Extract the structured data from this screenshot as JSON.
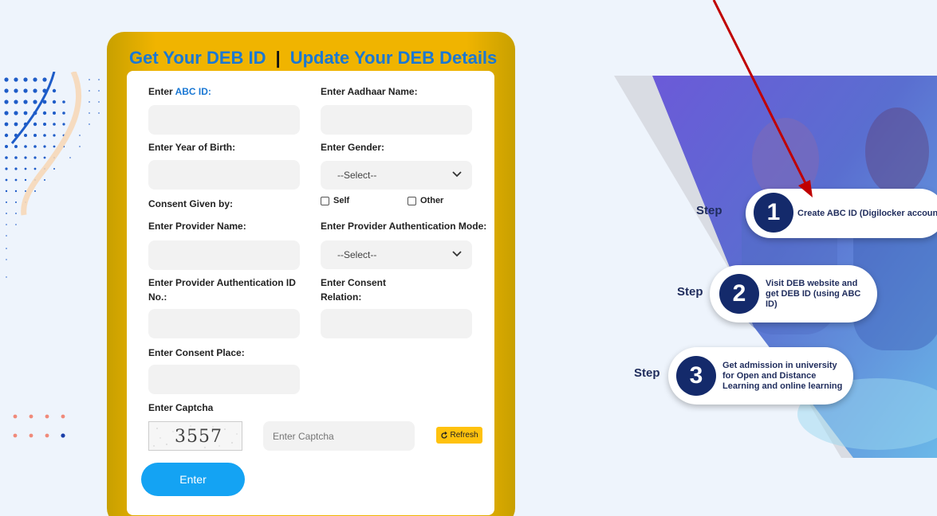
{
  "tabs": {
    "get_id": "Get Your DEB ID",
    "separator": "|",
    "update": "Update Your DEB Details"
  },
  "form": {
    "abc_id_prefix": "Enter ",
    "abc_id_accent": "ABC ID:",
    "aadhaar_name": "Enter Aadhaar Name:",
    "year_of_birth": "Enter Year of Birth:",
    "gender": "Enter Gender:",
    "gender_select": "--Select--",
    "consent_given_by": "Consent Given by:",
    "consent_self": "Self",
    "consent_other": "Other",
    "provider_name": "Enter Provider Name:",
    "provider_auth_mode": "Enter Provider Authentication Mode:",
    "auth_mode_select": "--Select--",
    "provider_auth_id": "Enter Provider Authentication ID No.:",
    "consent_relation": "Enter Consent Relation:",
    "consent_place": "Enter Consent Place:",
    "captcha_label": "Enter Captcha",
    "captcha_value": "3557",
    "captcha_placeholder": "Enter Captcha",
    "refresh_label": "Refresh",
    "enter_label": "Enter"
  },
  "steps": {
    "word": "Step",
    "items": [
      {
        "num": "1",
        "text": "Create ABC ID (Digilocker account)"
      },
      {
        "num": "2",
        "text": "Visit DEB website and get DEB ID (using ABC ID)"
      },
      {
        "num": "3",
        "text": "Get admission in university for Open and Distance Learning and online learning"
      }
    ]
  },
  "colors": {
    "accent": "#1a78d4",
    "card": "#f0b400",
    "enter": "#14a3f3",
    "step_navy": "#142a6b",
    "arrow": "#c00000"
  }
}
